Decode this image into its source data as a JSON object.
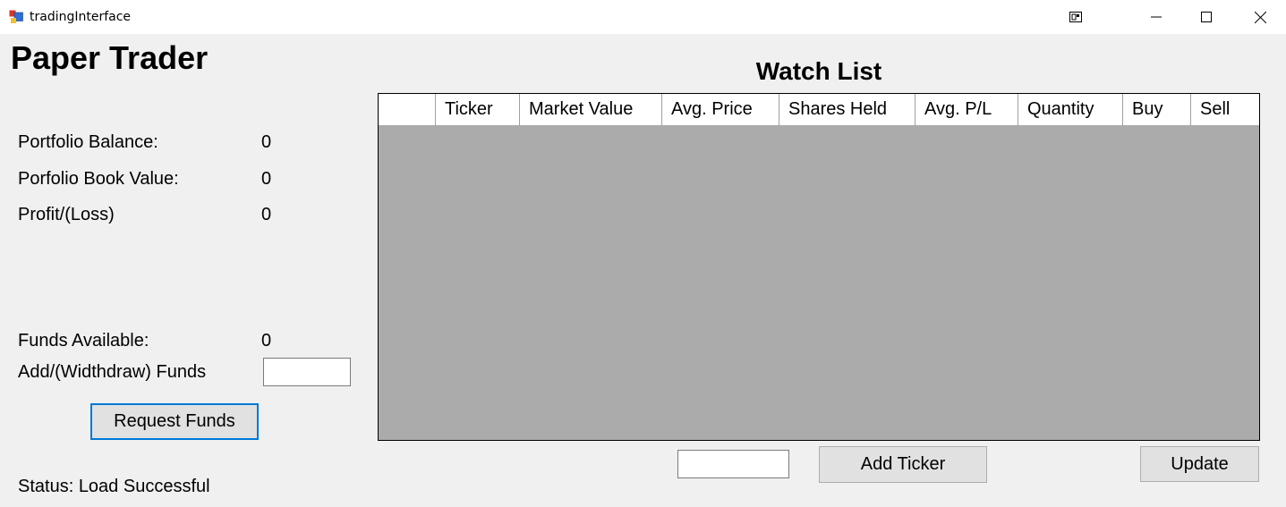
{
  "window": {
    "title": "tradingInterface"
  },
  "app": {
    "title": "Paper Trader"
  },
  "portfolio": {
    "balance_label": "Portfolio Balance:",
    "balance_value": "0",
    "book_value_label": "Porfolio Book Value:",
    "book_value_value": "0",
    "profit_label": "Profit/(Loss)",
    "profit_value": "0"
  },
  "funds": {
    "available_label": "Funds Available:",
    "available_value": "0",
    "add_label": "Add/(Widthdraw) Funds",
    "input_value": "",
    "request_button": "Request Funds"
  },
  "status": {
    "text": "Status: Load Successful"
  },
  "watchlist": {
    "title": "Watch List",
    "columns": [
      "",
      "Ticker",
      "Market Value",
      "Avg. Price",
      "Shares Held",
      "Avg. P/L",
      "Quantity",
      "Buy",
      "Sell"
    ],
    "rows": [],
    "ticker_input_value": "",
    "add_ticker_button": "Add Ticker",
    "update_button": "Update"
  },
  "icons": {
    "app": "app-icon",
    "snap": "snap-layout-icon",
    "minimize": "minimize-icon",
    "maximize": "maximize-icon",
    "close": "close-icon"
  },
  "colors": {
    "window_bg": "#f0f0f0",
    "grid_bg": "#ababab",
    "focus_border": "#0078d7",
    "button_bg": "#e1e1e1"
  }
}
